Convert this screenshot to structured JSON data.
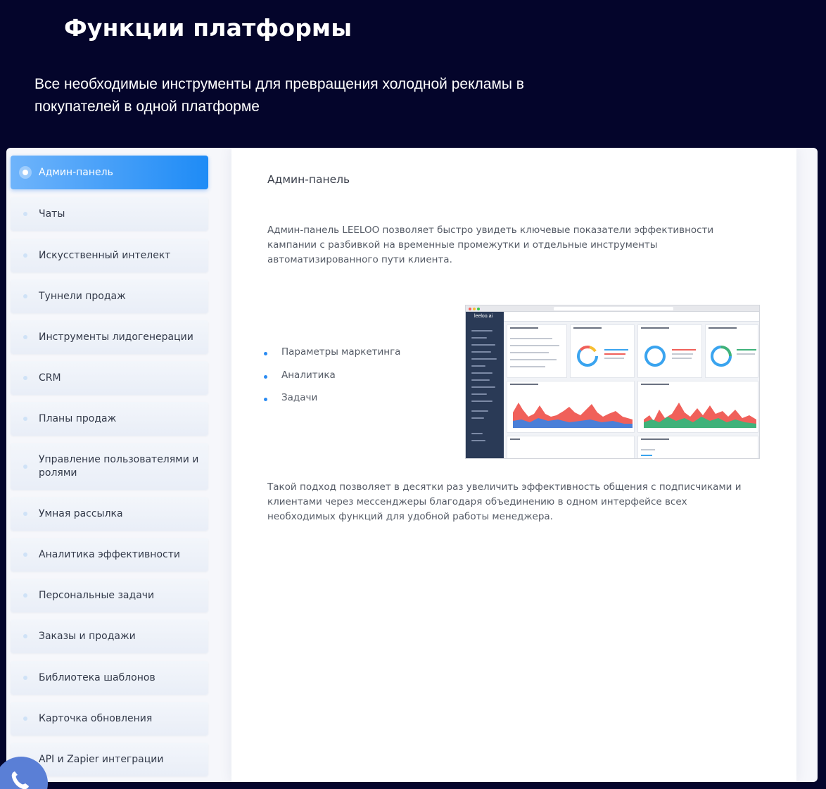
{
  "hero": {
    "title": "Функции платформы",
    "subtitle": "Все необходимые инструменты для превращения холодной рекламы в покупателей в одной платформе"
  },
  "menu": {
    "items": [
      {
        "label": "Админ-панель",
        "active": true
      },
      {
        "label": "Чаты"
      },
      {
        "label": "Искусственный интелект"
      },
      {
        "label": "Туннели продаж"
      },
      {
        "label": "Инструменты лидогенерации"
      },
      {
        "label": "CRM"
      },
      {
        "label": "Планы продаж"
      },
      {
        "label": "Управление пользователями и ролями"
      },
      {
        "label": "Умная рассылка"
      },
      {
        "label": "Аналитика эффективности"
      },
      {
        "label": "Персональные задачи"
      },
      {
        "label": "Заказы и продажи"
      },
      {
        "label": "Библиотека шаблонов"
      },
      {
        "label": "Карточка обновления"
      },
      {
        "label": "API и Zapier интеграции"
      }
    ]
  },
  "content": {
    "title": "Админ-панель",
    "intro": "Админ-панель LEELOO позволяет быстро увидеть ключевые показатели эффективности кампании с разбивкой на временные промежутки и отдельные инструменты автоматизированного пути клиента.",
    "bullets": [
      "Параметры маркетинга",
      "Аналитика",
      "Задачи"
    ],
    "outro": "Такой подход позволяет в десятки раз увеличить эффективность общения с подписчиками и клиентами через мессенджеры благодаря объединению в одном интерфейсе всех необходимых функций для удобной работы менеджера.",
    "screenshot_brand": "leeloo.ai"
  },
  "colors": {
    "hero_bg": "#04052b",
    "accent": "#1e8bf6",
    "chart_red": "#f0605a",
    "chart_blue": "#4a7fd8",
    "chart_green": "#3fb27a"
  },
  "icons": {
    "phone": "phone-icon",
    "menu_bullet": "dot-icon",
    "active_bullet": "radio-icon"
  }
}
